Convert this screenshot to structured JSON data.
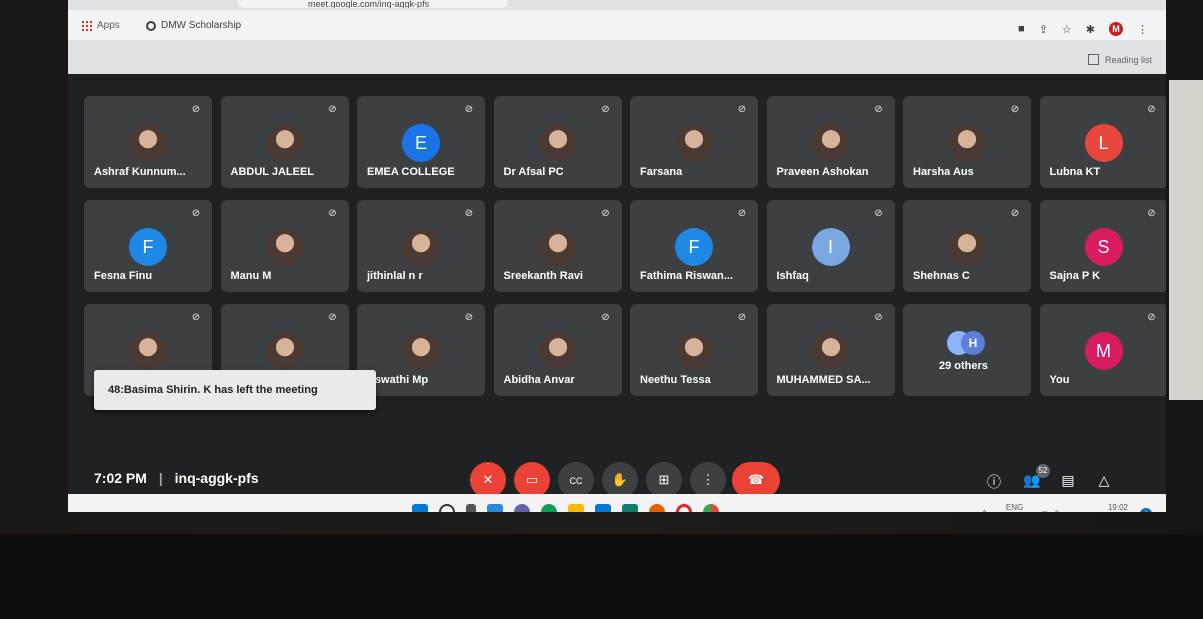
{
  "browser": {
    "url_fragment": "meet.google.com/inq-aggk-pfs",
    "bookmarks": [
      {
        "label": "Apps"
      },
      {
        "label": "DMW Scholarship"
      }
    ],
    "profile_initial": "M",
    "reading_list_label": "Reading list"
  },
  "meet": {
    "participants": [
      {
        "name": "Ashraf Kunnum...",
        "avatar": "photo"
      },
      {
        "name": "ABDUL JALEEL",
        "avatar": "photo"
      },
      {
        "name": "EMEA COLLEGE",
        "avatar": "letter",
        "initial": "E",
        "color": "#1a73e8"
      },
      {
        "name": "Dr Afsal PC",
        "avatar": "photo"
      },
      {
        "name": "Farsana",
        "avatar": "photo"
      },
      {
        "name": "Praveen Ashokan",
        "avatar": "photo"
      },
      {
        "name": "Harsha Aus",
        "avatar": "photo"
      },
      {
        "name": "Lubna KT",
        "avatar": "letter",
        "initial": "L",
        "color": "#e8453c"
      },
      {
        "name": "Fesna Finu",
        "avatar": "letter",
        "initial": "F",
        "color": "#1e88e5"
      },
      {
        "name": "Manu M",
        "avatar": "photo"
      },
      {
        "name": "jithinlal n r",
        "avatar": "photo"
      },
      {
        "name": "Sreekanth Ravi",
        "avatar": "photo"
      },
      {
        "name": "Fathima Riswan...",
        "avatar": "letter",
        "initial": "F",
        "color": "#1e88e5"
      },
      {
        "name": "Ishfaq",
        "avatar": "letter",
        "initial": "I",
        "color": "#7aa7e0"
      },
      {
        "name": "Shehnas C",
        "avatar": "photo"
      },
      {
        "name": "Sajna P K",
        "avatar": "letter",
        "initial": "S",
        "color": "#d81b60"
      },
      {
        "name": "",
        "avatar": "photo"
      },
      {
        "name": "",
        "avatar": "photo"
      },
      {
        "name": "Aswathi Mp",
        "avatar": "photo"
      },
      {
        "name": "Abidha Anvar",
        "avatar": "photo"
      },
      {
        "name": "Neethu Tessa",
        "avatar": "photo"
      },
      {
        "name": "MUHAMMED SA...",
        "avatar": "photo"
      },
      {
        "name": "29 others",
        "avatar": "stack",
        "initial": "H"
      },
      {
        "name": "You",
        "avatar": "letter",
        "initial": "M",
        "color": "#d81b60"
      }
    ],
    "toast": "48:Basima Shirin. K has left the meeting",
    "time": "7:02 PM",
    "separator": "|",
    "meeting_code": "inq-aggk-pfs",
    "participant_badge": "52"
  },
  "taskbar": {
    "lang_top": "ENG",
    "lang_bottom": "IN",
    "time": "19:02",
    "date": "26-02-2022"
  },
  "colors": {
    "meet_bg": "#202124",
    "tile_bg": "#3c4043",
    "end_call": "#ea4335"
  }
}
